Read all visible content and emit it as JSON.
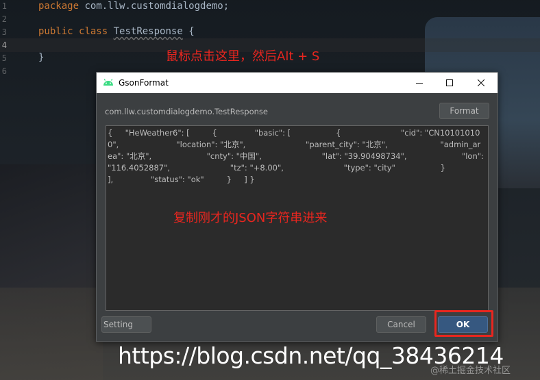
{
  "editor": {
    "line_numbers": [
      "1",
      "2",
      "3",
      "4",
      "5",
      "6"
    ],
    "line1": {
      "keyword": "package",
      "text": " com.llw.customdialogdemo;"
    },
    "line3": {
      "keyword1": "public",
      "keyword2": "class",
      "class_name": "TestResponse",
      "brace": " {"
    },
    "line5": {
      "text": "}"
    }
  },
  "annotations": {
    "click_hint": "鼠标点击这里，然后Alt + S",
    "paste_hint": "复制刚才的JSON字符串进来"
  },
  "dialog": {
    "title": "GsonFormat",
    "class_path": "com.llw.customdialogdemo.TestResponse",
    "format_label": "Format",
    "json_content": "{     \"HeWeather6\": [         {               \"basic\": [                  {                        \"cid\": \"CN101010100\",                       \"location\": \"北京\",                        \"parent_city\": \"北京\",                     \"admin_area\": \"北京\",                      \"cnty\": \"中国\",                        \"lat\": \"39.90498734\",                      \"lon\": \"116.4052887\",                        \"tz\": \"+8.00\",                        \"type\": \"city\"                  }               ],               \"status\": \"ok\"         }     ] }",
    "setting_label": "Setting",
    "cancel_label": "Cancel",
    "ok_label": "OK",
    "window_controls": [
      "minimize-icon",
      "maximize-icon",
      "close-icon"
    ]
  },
  "watermark": {
    "url": "https://blog.csdn.net/qq_38436214",
    "community": "@稀土掘金技术社区"
  },
  "colors": {
    "annotation_red": "#e8261f",
    "ok_blue": "#365880",
    "keyword_orange": "#cc7832",
    "code_text": "#a9b7c6",
    "dialog_bg": "#3c3f41"
  }
}
